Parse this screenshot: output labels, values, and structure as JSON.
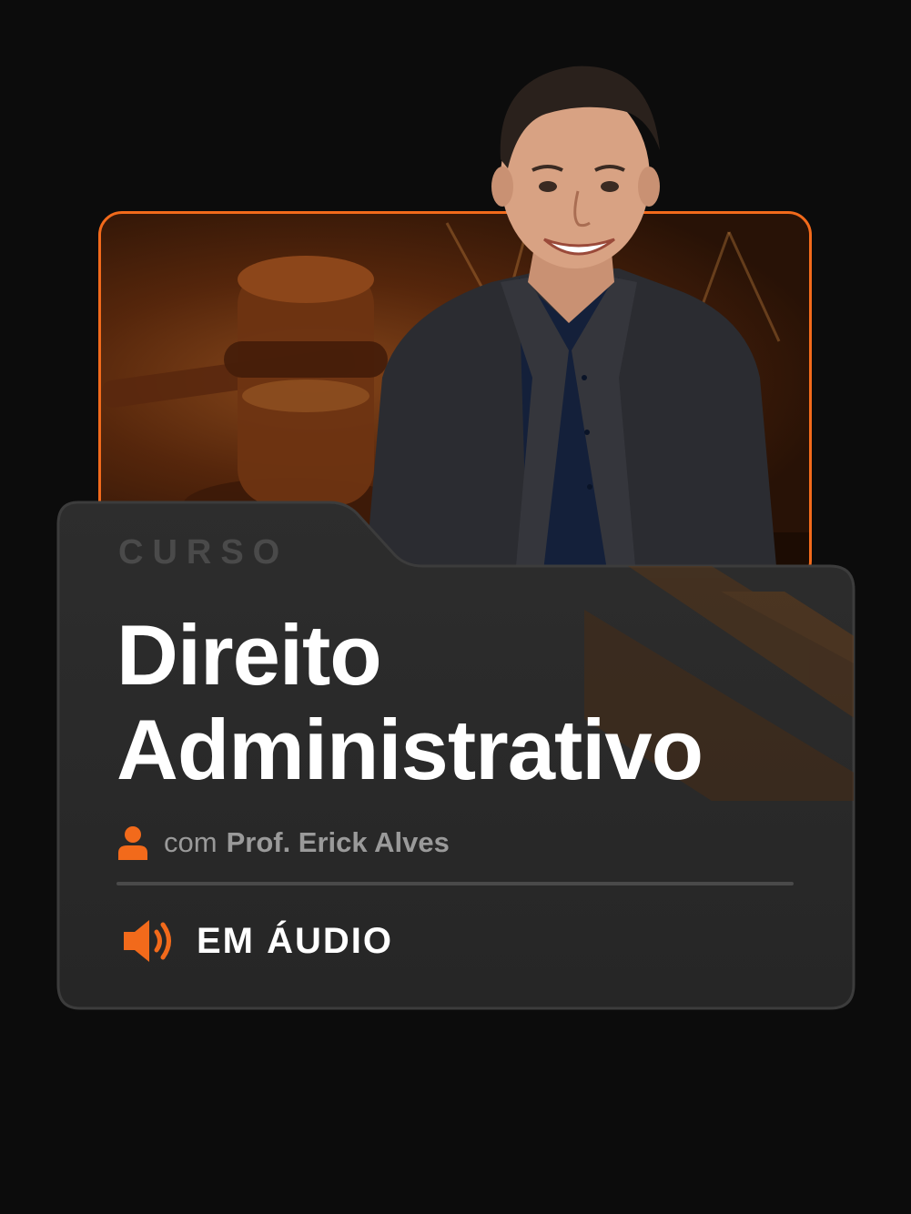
{
  "card": {
    "category": "CURSO",
    "title_line1": "Direito",
    "title_line2": "Administrativo",
    "instructor_prefix": "com",
    "instructor_name": "Prof. Erick Alves",
    "format_label": "EM ÁUDIO"
  },
  "icons": {
    "person": "person-icon",
    "speaker": "speaker-icon",
    "gavel": "gavel-icon"
  },
  "colors": {
    "background": "#0c0c0c",
    "accent": "#f26a1b",
    "card": "#2a2a2a",
    "muted_text": "#9a9a9a",
    "title": "#ffffff"
  }
}
